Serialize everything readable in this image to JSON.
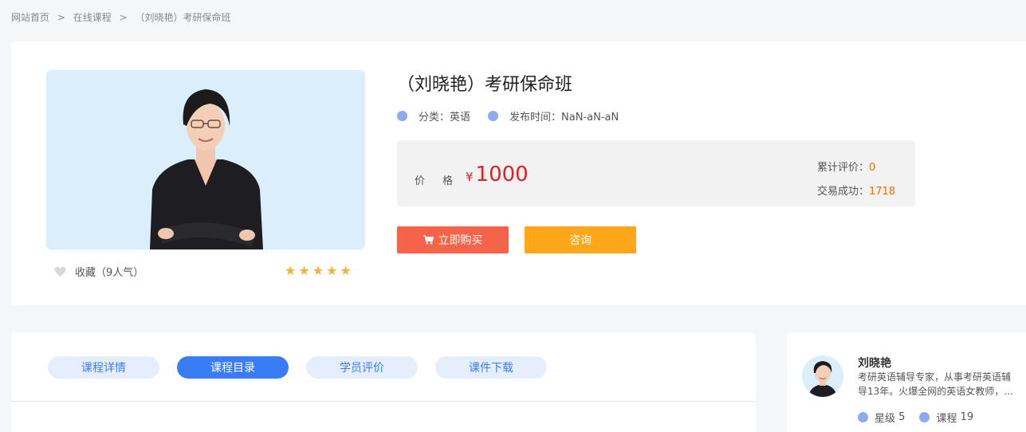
{
  "breadcrumb": {
    "home": "网站首页",
    "sep1": ">",
    "courses": "在线课程",
    "sep2": ">",
    "current": "（刘晓艳）考研保命班"
  },
  "course": {
    "title": "（刘晓艳）考研保命班",
    "category": "分类：英语",
    "publish_time": "发布时间：NaN-aN-aN",
    "favorite": "收藏（9人气）",
    "rating_stars": 5,
    "price_label": "价格",
    "currency_symbol": "¥",
    "price": "1000",
    "review_label": "累计评价：",
    "review_count": "0",
    "deal_label": "交易成功：",
    "deal_count": "1718",
    "buy_label": "立即购买",
    "consult_label": "咨询"
  },
  "tabs": [
    {
      "label": "课程详情",
      "active": false
    },
    {
      "label": "课程目录",
      "active": true
    },
    {
      "label": "学员评价",
      "active": false
    },
    {
      "label": "课件下载",
      "active": false
    }
  ],
  "teacher": {
    "name": "刘晓艳",
    "desc": "考研英语辅导专家，从事考研英语辅导13年。火爆全网的英语女教师，...",
    "level_label": "星级",
    "level": "5",
    "courses_label": "课程",
    "courses": "19"
  },
  "colors": {
    "accent_blue": "#3a7cf5",
    "price_red": "#e02020",
    "buy_button": "#f5644a",
    "consult_button": "#ffa719",
    "star": "#f6b03e",
    "highlight_orange": "#ff6a00"
  },
  "icons": [
    "heart-icon",
    "star-icon",
    "cart-icon",
    "dot-icon"
  ]
}
